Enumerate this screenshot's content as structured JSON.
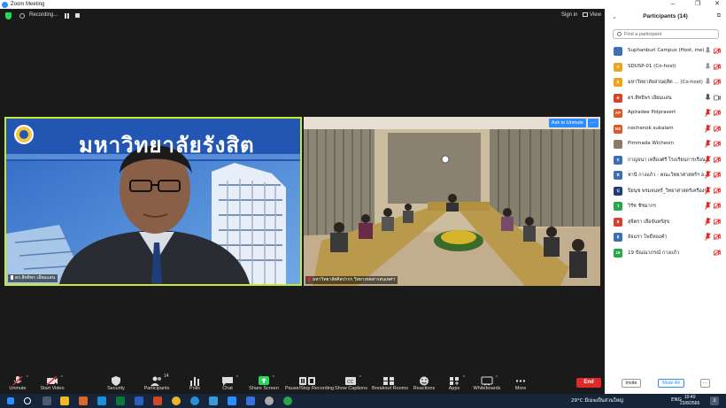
{
  "window": {
    "title": "Zoom Meeting",
    "minimize": "–",
    "maximize": "❐",
    "close": "✕"
  },
  "topbar": {
    "recording": "Recording...",
    "sign_in": "Sign in",
    "view": "View"
  },
  "videos": {
    "speaker": {
      "banner": "มหาวิทยาลัยรังสิต",
      "label": "ดร.สิทธิพร เอี่ยมแสน"
    },
    "room": {
      "label": "มหาวิทยาลัยศิลปากร วิทยาเขตสารสนเทศฯ",
      "ask_unmute": "Ask to Unmute",
      "more": "…"
    }
  },
  "toolbar": {
    "unmute": "Unmute",
    "start_video": "Start Video",
    "security": "Security",
    "participants": "Participants",
    "participants_count": "14",
    "polls": "Polls",
    "chat": "Chat",
    "share_screen": "Share Screen",
    "pause_stop_recording": "Pause/Stop Recording",
    "show_captions": "Show Captions",
    "breakout_rooms": "Breakout Rooms",
    "reactions": "Reactions",
    "apps": "Apps",
    "whiteboards": "Whiteboards",
    "more": "More",
    "end": "End"
  },
  "panel": {
    "title": "Participants (14)",
    "search_placeholder": "Find a participant",
    "invite": "Invite",
    "mute_all": "Mute All",
    "more": "…",
    "participants": [
      {
        "initials": "",
        "name": "Suphanburi Campus (Host, me)",
        "avatar_color": "#3d6fb6",
        "mic": "unmuted",
        "cam": "off"
      },
      {
        "initials": "S",
        "name": "SDUSP-01 (Co-host)",
        "avatar_color": "#f0a31a",
        "mic": "unmuted",
        "cam": "off"
      },
      {
        "initials": "ม",
        "name": "มหาวิทยาลัยสวนดุสิต ... (Co-host)",
        "avatar_color": "#f0a31a",
        "mic": "unmuted",
        "cam": "off"
      },
      {
        "initials": "ด",
        "name": "ดร.สิทธิพร เอี่ยมแสน",
        "avatar_color": "#d9412c",
        "mic": "talking",
        "cam": "on"
      },
      {
        "initials": "AP",
        "name": "Apiradee Polprasert",
        "avatar_color": "#e0582a",
        "mic": "muted",
        "cam": "off"
      },
      {
        "initials": "NS",
        "name": "nechanok sukalam",
        "avatar_color": "#e0582a",
        "mic": "muted",
        "cam": "off"
      },
      {
        "initials": "",
        "name": "Pimmada Wichesin",
        "avatar_color": "#8a7a6a",
        "mic": "muted",
        "cam": "off"
      },
      {
        "initials": "ก",
        "name": "กาญจนา เหลืองศรี โรงเรียนการเรือน",
        "avatar_color": "#3d6fb6",
        "mic": "muted",
        "cam": "off"
      },
      {
        "initials": "ห",
        "name": "หานี กางแก้ว - คณะวิทยาศาสตร์ฯ อ...",
        "avatar_color": "#3d6fb6",
        "mic": "muted",
        "cam": "off"
      },
      {
        "initials": "ป",
        "name": "ปิยนุช พรมจนทร์_วิทยาศาสตร์เครื่องจักร...",
        "avatar_color": "#1e3f7a",
        "mic": "muted",
        "cam": "off"
      },
      {
        "initials": "ว",
        "name": "วิรัช ชัชมากร",
        "avatar_color": "#2aa64a",
        "mic": "muted",
        "cam": "off"
      },
      {
        "initials": "ส",
        "name": "สุจิตรา เสือจันทร์สุข",
        "avatar_color": "#d9412c",
        "mic": "muted",
        "cam": "off"
      },
      {
        "initials": "อ",
        "name": "อัจฉรา โพธิ์ทองคำ",
        "avatar_color": "#3d6fb6",
        "mic": "muted",
        "cam": "off"
      },
      {
        "initials": "19",
        "name": "19 ปัณณาภรณ์ กางแก้ว",
        "avatar_color": "#2aa64a",
        "mic": "none",
        "cam": "off"
      }
    ]
  },
  "taskbar": {
    "weather": "29°C  มีเมฆเป็นส่วนใหญ่",
    "lang": "ENG",
    "time": "10:40",
    "date": "23/8/2566",
    "notif": "3"
  },
  "colors": {
    "accent": "#2d8cff",
    "end": "#e02828",
    "speaker_border": "#c7e82c",
    "taskbar": "#16253a"
  }
}
